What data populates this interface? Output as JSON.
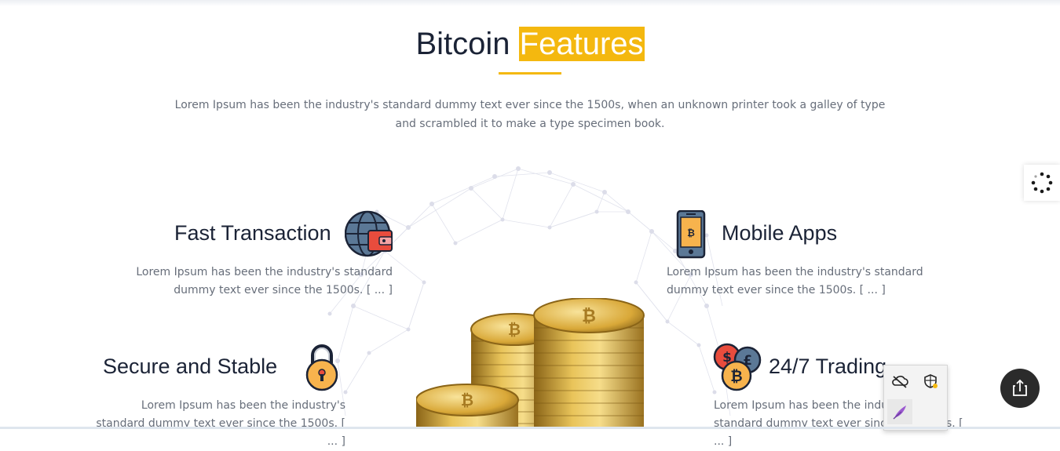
{
  "section": {
    "title_main": "Bitcoin",
    "title_highlight": "Features",
    "intro": "Lorem Ipsum has been the industry's standard dummy text ever since the 1500s, when an unknown printer took a galley of type and scrambled it to make a type specimen book."
  },
  "features": [
    {
      "title": "Fast Transaction",
      "desc": "Lorem Ipsum has been the industry's standard dummy text ever since the 1500s. [ ... ]",
      "icon": "globe-wallet-icon"
    },
    {
      "title": "Mobile Apps",
      "desc": "Lorem Ipsum has been the industry's standard dummy text ever since the 1500s. [ ... ]",
      "icon": "mobile-bitcoin-icon"
    },
    {
      "title": "Secure and Stable",
      "desc": "Lorem Ipsum has been the industry's standard dummy text ever since the 1500s. [ ... ]",
      "icon": "padlock-icon"
    },
    {
      "title": "24/7 Trading",
      "desc": "Lorem Ipsum has been the industry's standard dummy text ever since the 1500s. [ ... ]",
      "icon": "currency-coins-icon"
    }
  ],
  "colors": {
    "accent": "#f4b80f",
    "heading": "#1b2336",
    "text": "#676e7a"
  },
  "widgets": {
    "loader_icon": "spinner-icon",
    "share_icon": "share-icon",
    "extension_icons": [
      "cloud-off-icon",
      "shield-icon",
      "feather-icon"
    ]
  }
}
